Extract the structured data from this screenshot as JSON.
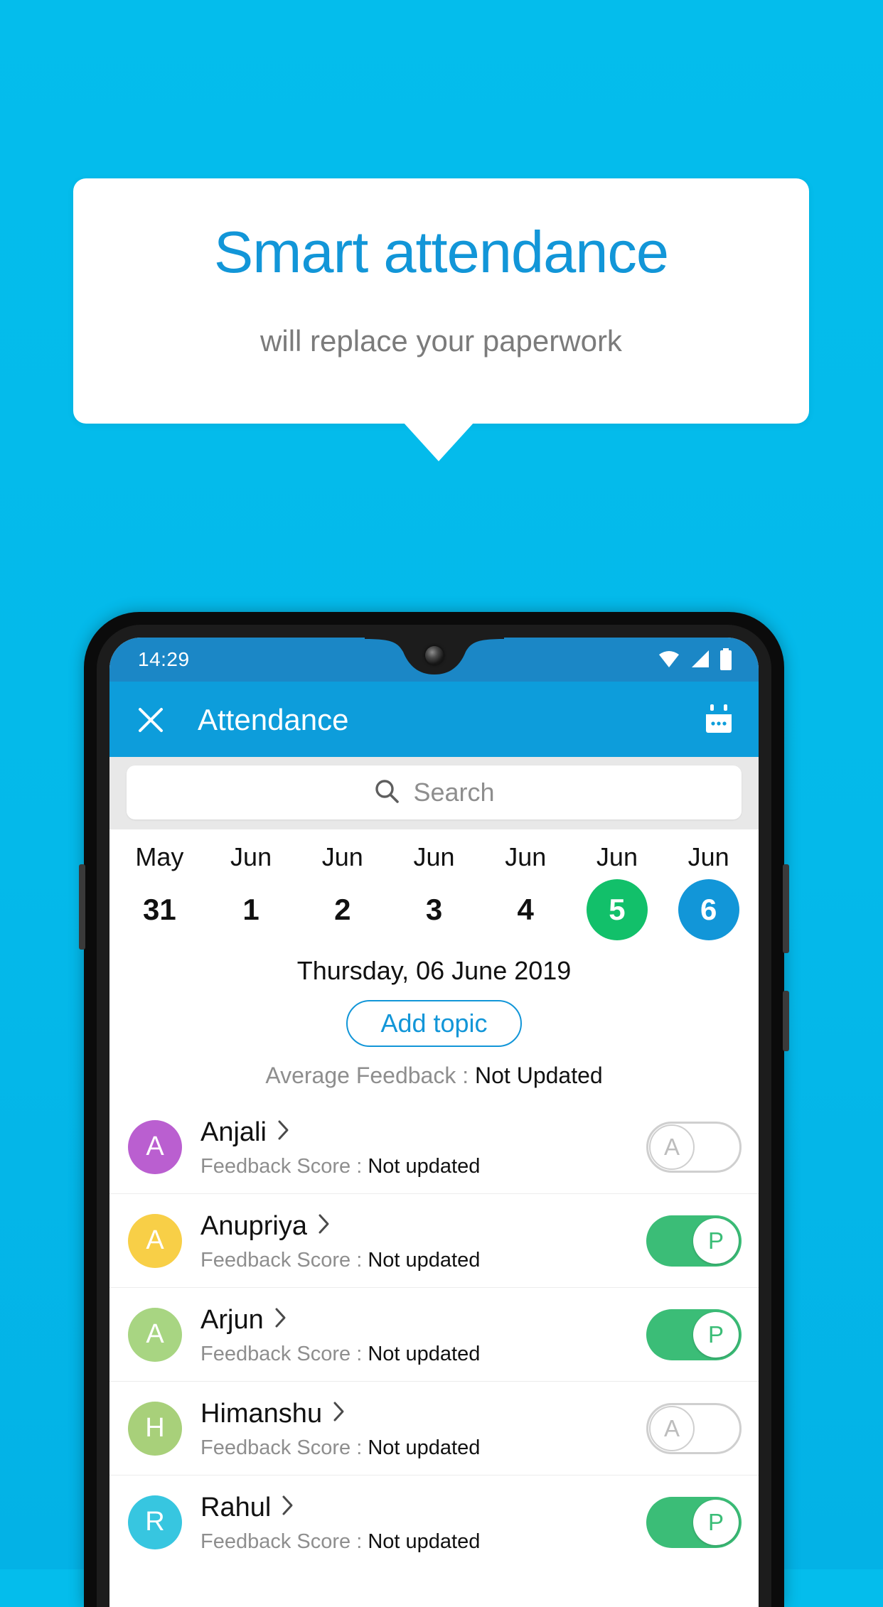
{
  "promo": {
    "title": "Smart attendance",
    "subtitle": "will replace your paperwork",
    "bg_color": "#04bdec",
    "title_color": "#1296d8",
    "card_color": "#ffffff"
  },
  "phone": {
    "status_bar": {
      "time": "14:29",
      "icons": [
        "wifi-icon",
        "signal-icon",
        "battery-icon"
      ],
      "bg_color": "#1b87c6"
    },
    "app_bar": {
      "close_icon": "close-icon",
      "title": "Attendance",
      "action_icon": "calendar-icon",
      "bg_color": "#0d9ddb"
    },
    "search": {
      "icon": "search-icon",
      "placeholder": "Search",
      "value": ""
    },
    "date_strip": [
      {
        "month": "May",
        "day": "31",
        "state": "normal"
      },
      {
        "month": "Jun",
        "day": "1",
        "state": "normal"
      },
      {
        "month": "Jun",
        "day": "2",
        "state": "normal"
      },
      {
        "month": "Jun",
        "day": "3",
        "state": "normal"
      },
      {
        "month": "Jun",
        "day": "4",
        "state": "normal"
      },
      {
        "month": "Jun",
        "day": "5",
        "state": "green"
      },
      {
        "month": "Jun",
        "day": "6",
        "state": "blue"
      }
    ],
    "selected_date": "Thursday, 06 June 2019",
    "add_topic_label": "Add topic",
    "average_feedback": {
      "label": "Average Feedback : ",
      "value": "Not Updated"
    },
    "feedback_label": "Feedback Score : ",
    "students": [
      {
        "name": "Anjali",
        "initial": "A",
        "avatar_color": "#ba5fd0",
        "feedback_value": "Not updated",
        "attendance": "A",
        "attendance_state": "absent"
      },
      {
        "name": "Anupriya",
        "initial": "A",
        "avatar_color": "#f8cf47",
        "feedback_value": "Not updated",
        "attendance": "P",
        "attendance_state": "present"
      },
      {
        "name": "Arjun",
        "initial": "A",
        "avatar_color": "#a8d582",
        "feedback_value": "Not updated",
        "attendance": "P",
        "attendance_state": "present"
      },
      {
        "name": "Himanshu",
        "initial": "H",
        "avatar_color": "#a8d07a",
        "feedback_value": "Not updated",
        "attendance": "A",
        "attendance_state": "absent"
      },
      {
        "name": "Rahul",
        "initial": "R",
        "avatar_color": "#37c6e0",
        "feedback_value": "Not updated",
        "attendance": "P",
        "attendance_state": "present"
      }
    ],
    "colors": {
      "present_green": "#3bbd77",
      "date_green": "#12c06a",
      "date_blue": "#1296d8"
    }
  }
}
